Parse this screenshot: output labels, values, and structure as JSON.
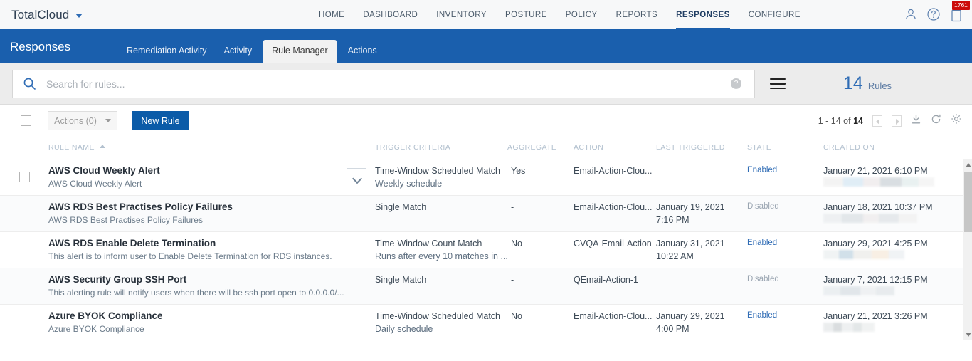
{
  "topbar": {
    "brand": "TotalCloud",
    "brand_caret_icon": "chevron-down-icon",
    "nav": [
      {
        "label": "HOME",
        "active": false
      },
      {
        "label": "DASHBOARD",
        "active": false
      },
      {
        "label": "INVENTORY",
        "active": false
      },
      {
        "label": "POSTURE",
        "active": false
      },
      {
        "label": "POLICY",
        "active": false
      },
      {
        "label": "REPORTS",
        "active": false
      },
      {
        "label": "RESPONSES",
        "active": true
      },
      {
        "label": "CONFIGURE",
        "active": false
      }
    ],
    "icons": [
      "user-icon",
      "help-icon",
      "notifications-icon"
    ],
    "notification_badge": "1761"
  },
  "subheader": {
    "title": "Responses",
    "tabs": [
      {
        "label": "Remediation Activity",
        "active": false
      },
      {
        "label": "Activity",
        "active": false
      },
      {
        "label": "Rule Manager",
        "active": true
      },
      {
        "label": "Actions",
        "active": false
      }
    ]
  },
  "search": {
    "placeholder": "Search for rules...",
    "value": "",
    "help_label": "?",
    "icon": "search-icon",
    "menu_icon": "hamburger-icon"
  },
  "rule_count": {
    "number": "14",
    "label": "Rules"
  },
  "toolbar": {
    "select_all_checkbox": "",
    "actions_label": "Actions (0)",
    "new_rule_label": "New Rule",
    "pager_text": "1 - 14 of ",
    "pager_total": "14",
    "icons": [
      "prev-page-icon",
      "next-page-icon",
      "download-icon",
      "refresh-icon",
      "settings-gear-icon"
    ]
  },
  "table": {
    "columns": [
      {
        "key": "rule_name",
        "label": "RULE NAME",
        "sorted": "asc"
      },
      {
        "key": "trigger_criteria",
        "label": "TRIGGER CRITERIA"
      },
      {
        "key": "aggregate",
        "label": "AGGREGATE"
      },
      {
        "key": "action",
        "label": "ACTION"
      },
      {
        "key": "last_triggered",
        "label": "LAST TRIGGERED"
      },
      {
        "key": "state",
        "label": "STATE"
      },
      {
        "key": "created_on",
        "label": "CREATED ON"
      }
    ],
    "rows": [
      {
        "name": "AWS Cloud Weekly Alert",
        "desc": "AWS Cloud Weekly Alert",
        "trigger": "Time-Window Scheduled Match",
        "trigger_sub": "Weekly schedule",
        "aggregate": "Yes",
        "action": "Email-Action-Clou...",
        "last_triggered": "",
        "last_triggered_2": "",
        "state": "Enabled",
        "created_on": "January 21, 2021 6:10 PM",
        "expandable": true
      },
      {
        "name": "AWS RDS Best Practises Policy Failures",
        "desc": "AWS RDS Best Practises Policy Failures",
        "trigger": "Single Match",
        "trigger_sub": "",
        "aggregate": "-",
        "action": "Email-Action-Clou...",
        "last_triggered": "January 19, 2021",
        "last_triggered_2": "7:16 PM",
        "state": "Disabled",
        "created_on": "January 18, 2021 10:37 PM",
        "expandable": false
      },
      {
        "name": "AWS RDS Enable Delete Termination",
        "desc": "This alert is to inform user to Enable Delete Termination for RDS instances.",
        "trigger": "Time-Window Count Match",
        "trigger_sub": "Runs after every 10 matches in ...",
        "aggregate": "No",
        "action": "CVQA-Email-Action",
        "last_triggered": "January 31, 2021",
        "last_triggered_2": "10:22 AM",
        "state": "Enabled",
        "created_on": "January 29, 2021 4:25 PM",
        "expandable": false
      },
      {
        "name": "AWS Security Group SSH Port",
        "desc": "This alerting rule will notify users when there will be ssh port open to 0.0.0.0/...",
        "trigger": "Single Match",
        "trigger_sub": "",
        "aggregate": "-",
        "action": "QEmail-Action-1",
        "last_triggered": "",
        "last_triggered_2": "",
        "state": "Disabled",
        "created_on": "January 7, 2021 12:15 PM",
        "expandable": false
      },
      {
        "name": "Azure BYOK Compliance",
        "desc": "Azure BYOK Compliance",
        "trigger": "Time-Window Scheduled Match",
        "trigger_sub": "Daily schedule",
        "aggregate": "No",
        "action": "Email-Action-Clou...",
        "last_triggered": "January 29, 2021",
        "last_triggered_2": "4:00 PM",
        "state": "Enabled",
        "created_on": "January 21, 2021 3:26 PM",
        "expandable": false
      }
    ]
  },
  "colors": {
    "brand_blue": "#1a5fad",
    "accent_blue": "#2f6cb5",
    "button_blue": "#0b5ba8",
    "badge_red": "#cc0b0b",
    "header_grey": "#b3c1cf"
  }
}
